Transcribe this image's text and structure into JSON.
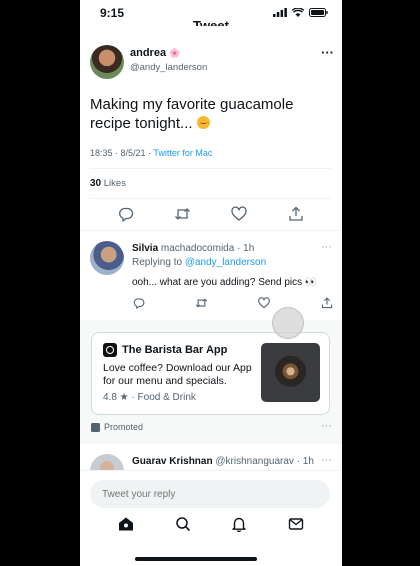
{
  "status": {
    "time": "9:15"
  },
  "header": {
    "title": "Tweet",
    "back_glyph": "←"
  },
  "tweet": {
    "author_name": "andrea",
    "author_emoji": "🌸",
    "author_handle": "@andy_landerson",
    "more": "···",
    "text": "Making my favorite guacamole recipe tonight...",
    "timestamp": "18:35 · 8/5/21 · ",
    "source": "Twitter for Mac",
    "likes_count": "30",
    "likes_label": " Likes"
  },
  "reply": {
    "name": "Silvia",
    "handle_time": " machadocomida · 1h",
    "replying_to_label": "Replying to ",
    "replying_to_handle": "@andy_landerson",
    "text": "ooh... what are you adding? Send pics 👀",
    "more": "···"
  },
  "promo": {
    "app_name": "The Barista Bar App",
    "description": "Love coffee? Download our App for our menu and specials.",
    "rating": "4.8 ★ · Food & Drink",
    "promoted_label": "Promoted",
    "more": "···"
  },
  "next_reply": {
    "name": "Guarav Krishnan",
    "handle_time": " @krishnanguarav · 1h",
    "more": "···"
  },
  "composer": {
    "placeholder": "Tweet your reply"
  },
  "icons": {
    "reply": "reply-icon",
    "retweet": "retweet-icon",
    "like": "heart-icon",
    "share": "share-icon",
    "home": "home-icon",
    "search": "search-icon",
    "notifications": "bell-icon",
    "messages": "mail-icon"
  },
  "colors": {
    "accent": "#1d9bf0",
    "text": "#0f1419",
    "muted": "#536471"
  }
}
